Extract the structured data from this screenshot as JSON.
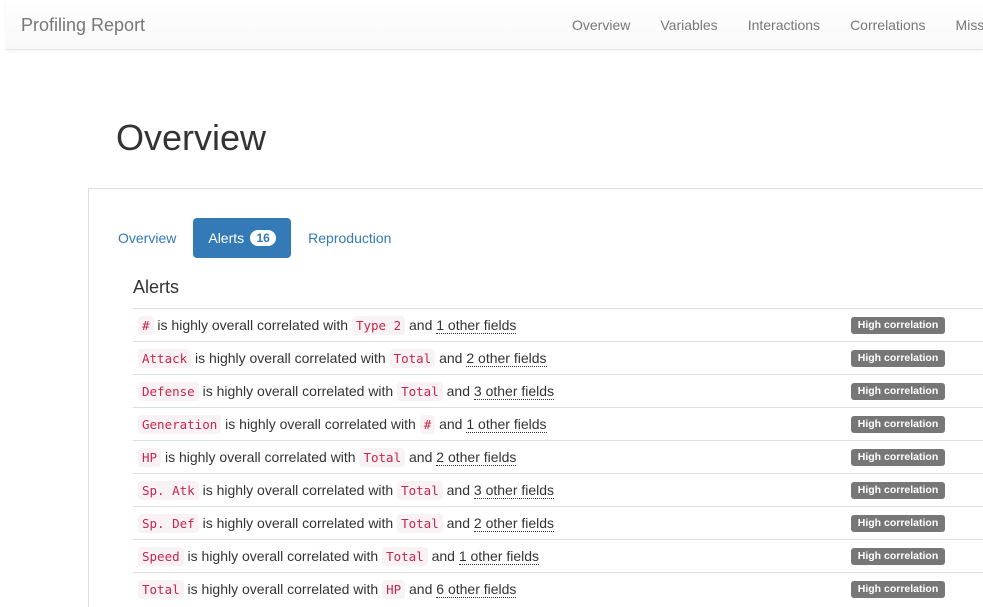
{
  "navbar": {
    "brand": "Profiling Report",
    "links": [
      "Overview",
      "Variables",
      "Interactions",
      "Correlations",
      "Missing values"
    ]
  },
  "page": {
    "title": "Overview"
  },
  "tabs": [
    {
      "label": "Overview",
      "active": false
    },
    {
      "label": "Alerts",
      "active": true,
      "badge": "16"
    },
    {
      "label": "Reproduction",
      "active": false
    }
  ],
  "alerts": {
    "title": "Alerts",
    "connector": "is highly overall correlated with",
    "and": "and",
    "items": [
      {
        "field": "#",
        "target": "Type 2",
        "others": "1 other fields",
        "label": "High correlation"
      },
      {
        "field": "Attack",
        "target": "Total",
        "others": "2 other fields",
        "label": "High correlation"
      },
      {
        "field": "Defense",
        "target": "Total",
        "others": "3 other fields",
        "label": "High correlation"
      },
      {
        "field": "Generation",
        "target": "#",
        "others": "1 other fields",
        "label": "High correlation"
      },
      {
        "field": "HP",
        "target": "Total",
        "others": "2 other fields",
        "label": "High correlation"
      },
      {
        "field": "Sp. Atk",
        "target": "Total",
        "others": "3 other fields",
        "label": "High correlation"
      },
      {
        "field": "Sp. Def",
        "target": "Total",
        "others": "2 other fields",
        "label": "High correlation"
      },
      {
        "field": "Speed",
        "target": "Total",
        "others": "1 other fields",
        "label": "High correlation"
      },
      {
        "field": "Total",
        "target": "HP",
        "others": "6 other fields",
        "label": "High correlation"
      }
    ]
  }
}
